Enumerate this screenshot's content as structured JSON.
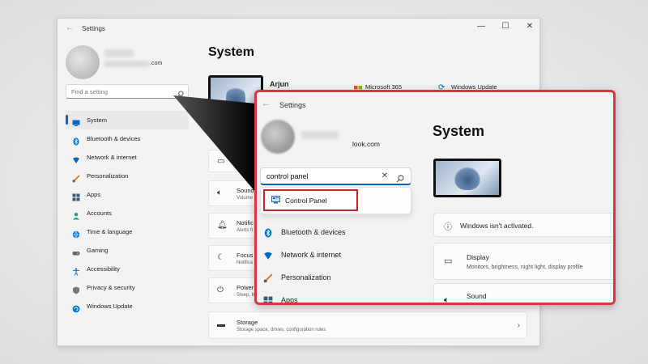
{
  "window": {
    "title": "Settings",
    "controls": {
      "minimize": "—",
      "maximize": "☐",
      "close": "✕"
    }
  },
  "profile": {
    "email_suffix": ".com"
  },
  "search": {
    "placeholder": "Find a setting"
  },
  "sidebar": {
    "items": [
      {
        "label": "System",
        "icon": "system-icon",
        "color": "#0067c0",
        "active": true
      },
      {
        "label": "Bluetooth & devices",
        "icon": "bluetooth-icon",
        "color": "#0078d4"
      },
      {
        "label": "Network & internet",
        "icon": "wifi-icon",
        "color": "#0067c0"
      },
      {
        "label": "Personalization",
        "icon": "brush-icon",
        "color": "#d77b29"
      },
      {
        "label": "Apps",
        "icon": "apps-icon",
        "color": "#3b5a7a"
      },
      {
        "label": "Accounts",
        "icon": "accounts-icon",
        "color": "#2a9d8f"
      },
      {
        "label": "Time & language",
        "icon": "globe-icon",
        "color": "#0078d4"
      },
      {
        "label": "Gaming",
        "icon": "gaming-icon",
        "color": "#666666"
      },
      {
        "label": "Accessibility",
        "icon": "accessibility-icon",
        "color": "#1c6fb5"
      },
      {
        "label": "Privacy & security",
        "icon": "shield-icon",
        "color": "#777777"
      },
      {
        "label": "Windows Update",
        "icon": "update-icon",
        "color": "#0078d4"
      }
    ]
  },
  "main": {
    "heading": "System",
    "user_name": "Arjun",
    "microsoft365": "Microsoft 365",
    "windows_update": "Windows Update",
    "cards": [
      {
        "title": "Sound",
        "subtitle": "Volume"
      },
      {
        "title": "Notific",
        "subtitle": "Alerts fr"
      },
      {
        "title": "Focus",
        "subtitle": "Notifica"
      },
      {
        "title": "Power",
        "subtitle": "Sleep, b"
      },
      {
        "title": "Storage",
        "subtitle": "Storage space, drives, configuration rules"
      }
    ]
  },
  "zoom": {
    "title": "Settings",
    "email_suffix": "look.com",
    "search_value": "control panel",
    "search_clear": "✕",
    "suggestion": "Control Panel",
    "nav": [
      {
        "label": "Bluetooth & devices",
        "icon": "bluetooth-icon",
        "color": "#0078d4"
      },
      {
        "label": "Network & internet",
        "icon": "wifi-icon",
        "color": "#0067c0"
      },
      {
        "label": "Personalization",
        "icon": "brush-icon",
        "color": "#d77b29"
      },
      {
        "label": "Apps",
        "icon": "apps-icon",
        "color": "#3b5a7a"
      }
    ],
    "heading": "System",
    "activation": "Windows isn't activated.",
    "display": {
      "title": "Display",
      "subtitle": "Monitors, brightness, night light, display profile"
    },
    "sound": {
      "title": "Sound"
    }
  },
  "colors": {
    "accent": "#0067c0",
    "highlight": "#d9363e"
  }
}
